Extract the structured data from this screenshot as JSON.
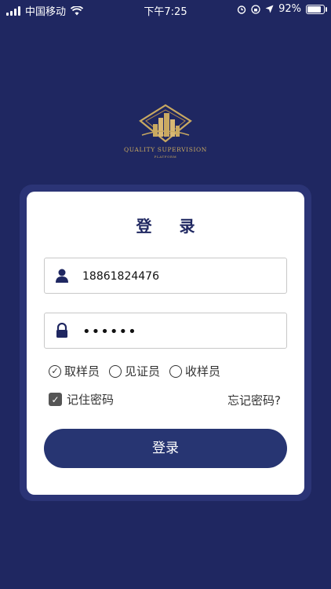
{
  "status_bar": {
    "carrier": "中国移动",
    "time": "下午7:25",
    "battery_text": "92%",
    "battery_level": 0.92,
    "icons": [
      "signal-icon",
      "wifi-icon",
      "alarm-icon",
      "lock-rotation-icon",
      "location-icon",
      "battery-icon"
    ]
  },
  "logo": {
    "line1": "QUALITY SUPERVISION",
    "line2": "PLATFORM",
    "color": "#c9a961"
  },
  "login": {
    "title": "登 录",
    "username": {
      "value": "18861824476",
      "icon": "user-icon"
    },
    "password": {
      "value": "••••••",
      "icon": "lock-icon"
    },
    "roles": [
      {
        "label": "取样员",
        "checked": true
      },
      {
        "label": "见证员",
        "checked": false
      },
      {
        "label": "收样员",
        "checked": false
      }
    ],
    "remember_label": "记住密码",
    "remember_checked": true,
    "forgot_label": "忘记密码?",
    "button_label": "登录"
  },
  "colors": {
    "background": "#1f2761",
    "card_border": "#2b3476",
    "button": "#273572",
    "title": "#1f2761"
  }
}
